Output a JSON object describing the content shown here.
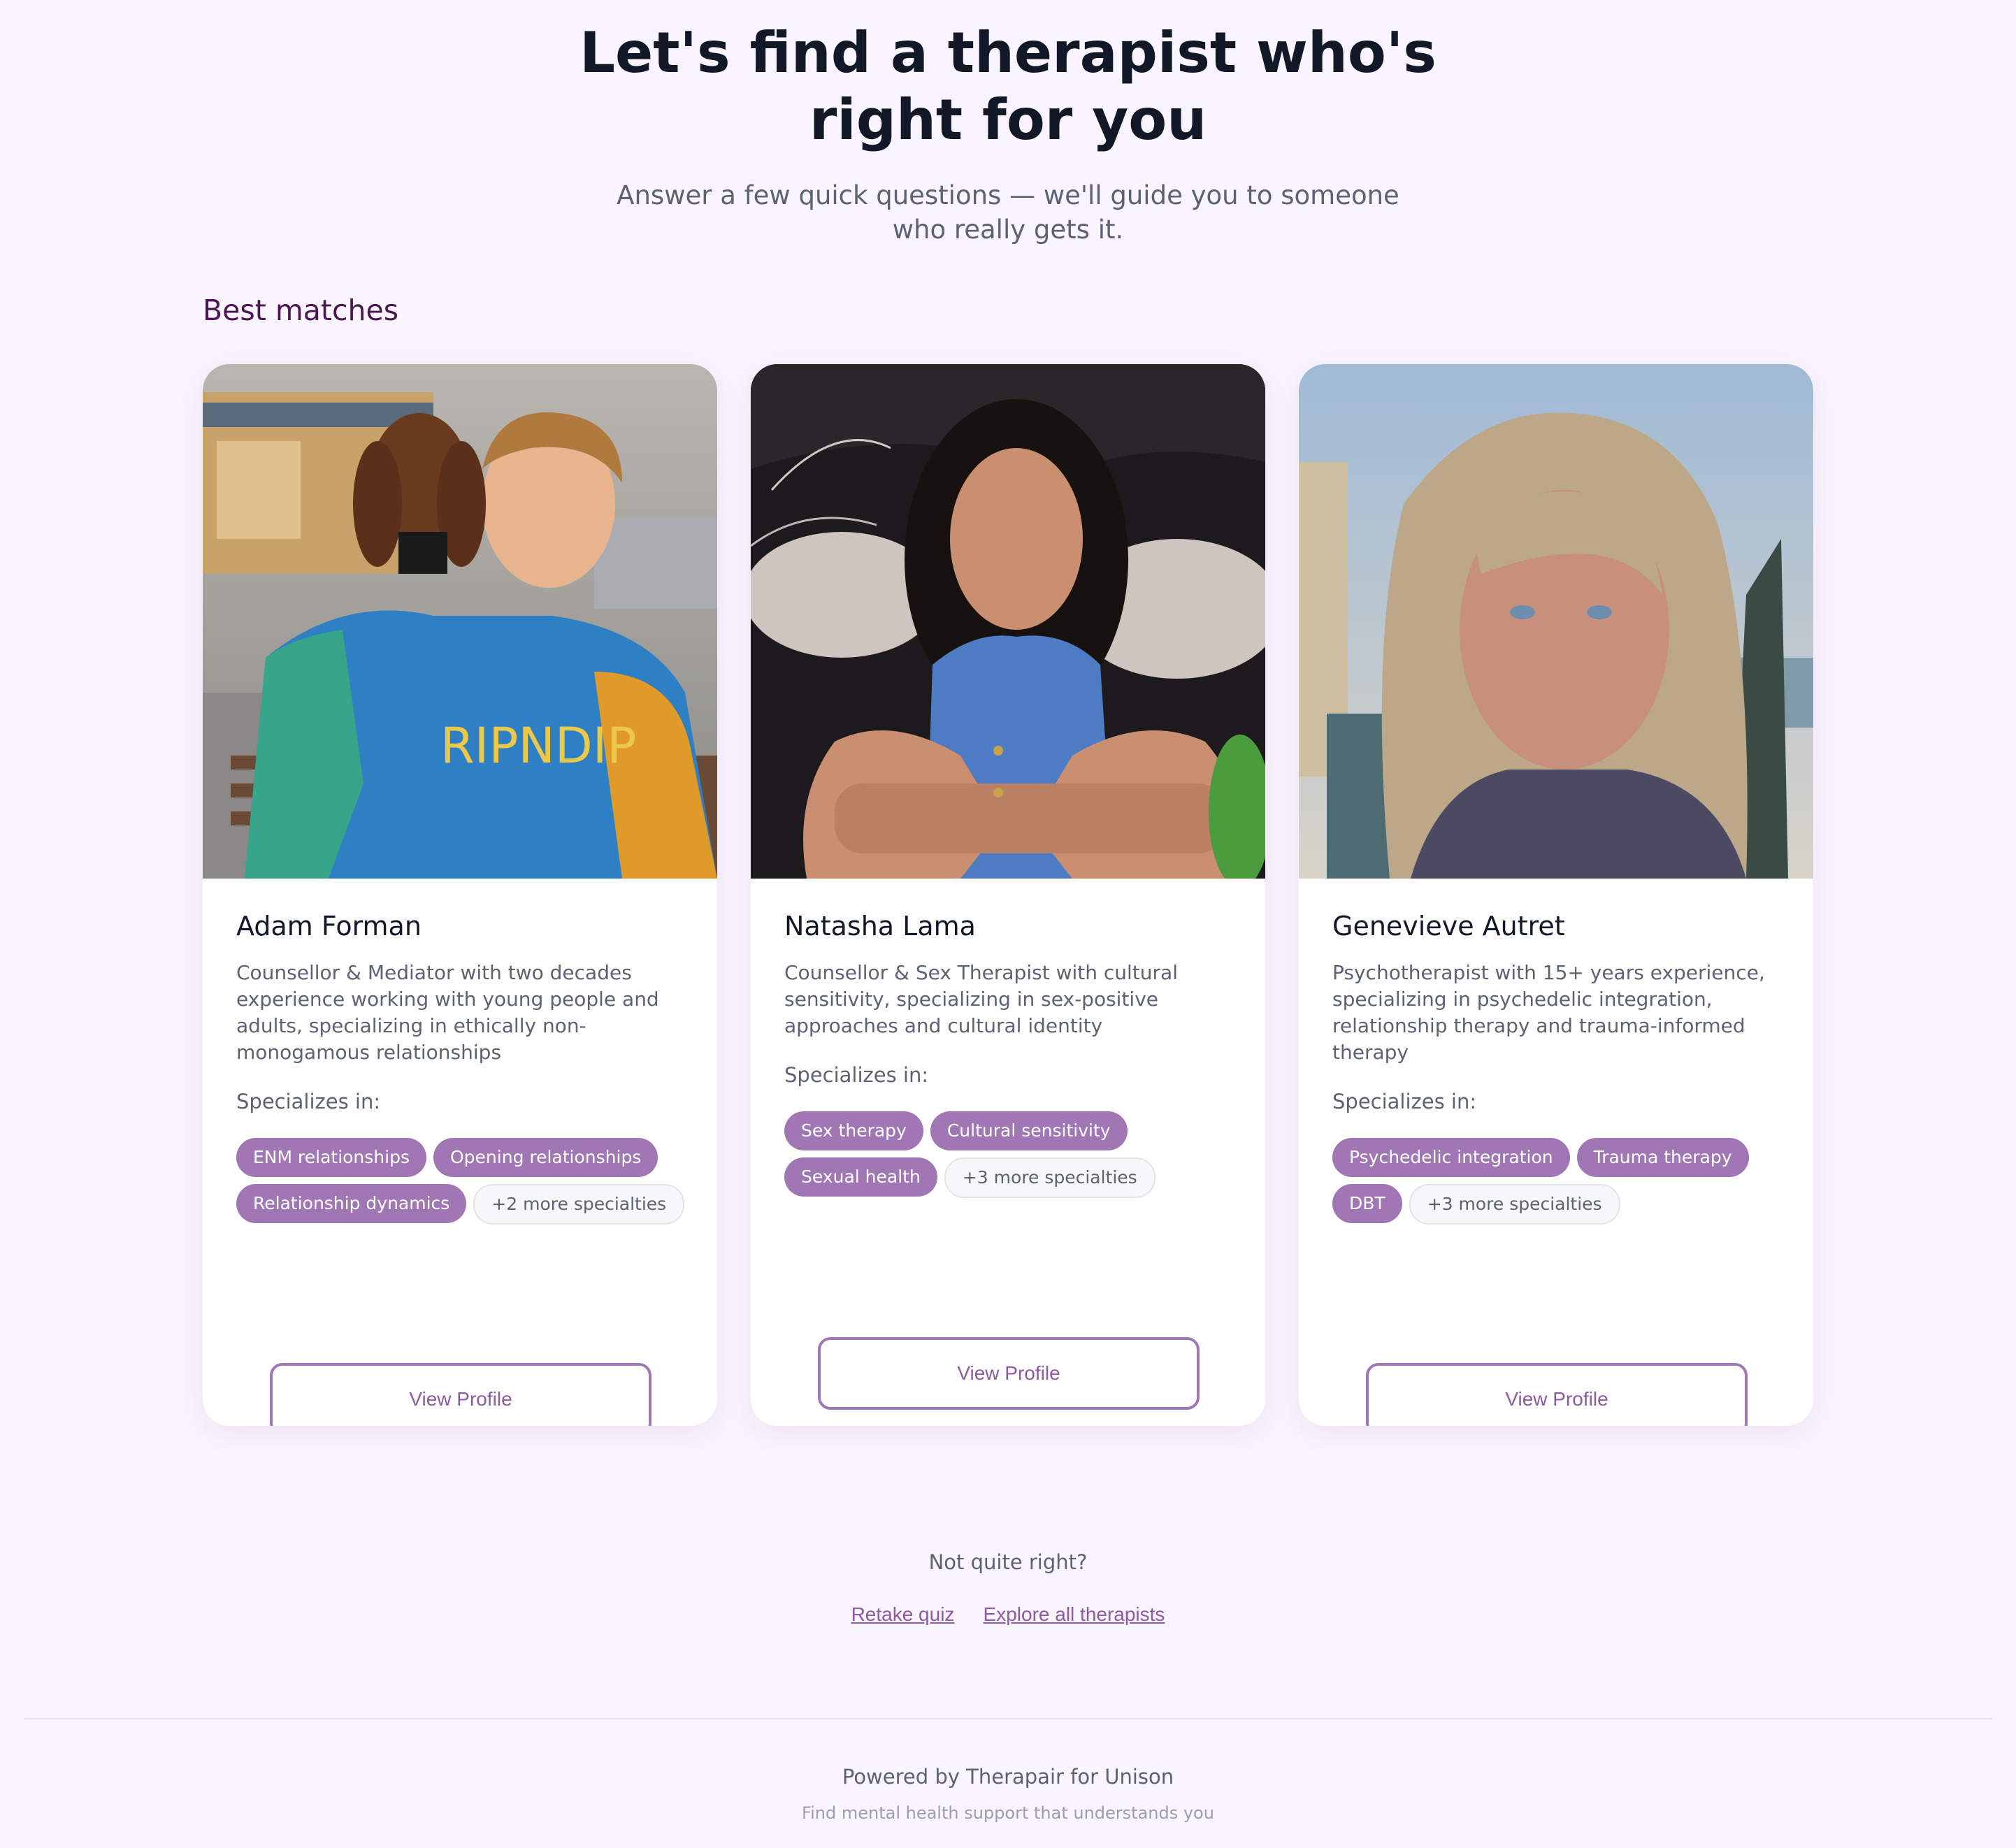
{
  "hero": {
    "title": "Let's find a therapist who's right for you",
    "subtitle": "Answer a few quick questions — we'll guide you to someone who really gets it."
  },
  "section": {
    "title": "Best matches"
  },
  "therapists": [
    {
      "name": "Adam Forman",
      "bio": "Counsellor & Mediator with two decades experience working with young people and adults, specializing in ethically non-monogamous relationships",
      "specializes_label": "Specializes in:",
      "specialties": [
        "ENM relationships",
        "Opening relationships",
        "Relationship dynamics"
      ],
      "more": "+2 more specialties",
      "button": "View Profile"
    },
    {
      "name": "Natasha Lama",
      "bio": "Counsellor & Sex Therapist with cultural sensitivity, specializing in sex-positive approaches and cultural identity",
      "specializes_label": "Specializes in:",
      "specialties": [
        "Sex therapy",
        "Cultural sensitivity",
        "Sexual health"
      ],
      "more": "+3 more specialties",
      "button": "View Profile"
    },
    {
      "name": "Genevieve Autret",
      "bio": "Psychotherapist with 15+ years experience, specializing in psychedelic integration, relationship therapy and trauma-informed therapy",
      "specializes_label": "Specializes in:",
      "specialties": [
        "Psychedelic integration",
        "Trauma therapy",
        "DBT"
      ],
      "more": "+3 more specialties",
      "button": "View Profile"
    }
  ],
  "footer": {
    "question": "Not quite right?",
    "retake": "Retake quiz",
    "explore": "Explore all therapists",
    "powered": "Powered by Therapair for Unison",
    "tagline": "Find mental health support that understands you"
  },
  "colors": {
    "accent": "#a176b4",
    "background": "#f9f4fe",
    "heading": "#111827",
    "section_title": "#4b1750"
  },
  "icons": {
    "photo_1": "therapist-photo",
    "photo_2": "therapist-photo",
    "photo_3": "therapist-photo"
  }
}
